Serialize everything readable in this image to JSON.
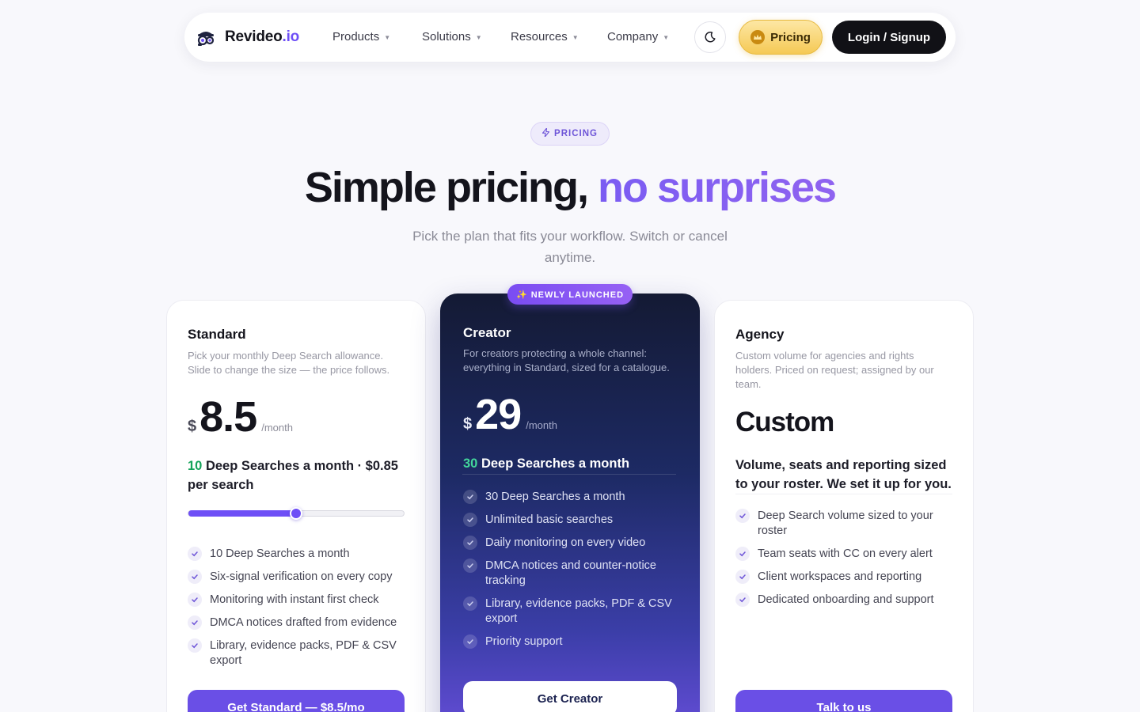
{
  "nav": {
    "brand": "Revideo",
    "brand_suffix": ".io",
    "items": [
      {
        "label": "Products"
      },
      {
        "label": "Solutions"
      },
      {
        "label": "Resources"
      },
      {
        "label": "Company"
      }
    ],
    "theme_icon": "moon-icon",
    "pricing_label": "Pricing",
    "login_label": "Login / Signup"
  },
  "hero": {
    "badge": "PRICING",
    "title_main": "Simple pricing,",
    "title_accent": "no surprises",
    "subtitle": "Pick the plan that fits your workflow. Switch or cancel anytime."
  },
  "plans": {
    "standard": {
      "name": "Standard",
      "desc": "Pick your monthly Deep Search allowance. Slide to change the size — the price follows.",
      "currency": "$",
      "price": "8.5",
      "per": "/month",
      "allowance_count": "10",
      "allowance_text": "Deep Searches a month · $0.85 per search",
      "slider_fraction": 0.5,
      "features": [
        "10 Deep Searches a month",
        "Six-signal verification on every copy",
        "Monitoring with instant first check",
        "DMCA notices drafted from evidence",
        "Library, evidence packs, PDF & CSV export"
      ],
      "cta": "Get Standard — $8.5/mo"
    },
    "creator": {
      "badge": "✨ NEWLY LAUNCHED",
      "name": "Creator",
      "desc": "For creators protecting a whole channel: everything in Standard, sized for a catalogue.",
      "currency": "$",
      "price": "29",
      "per": "/month",
      "allowance_count": "30",
      "allowance_text": "Deep Searches a month",
      "features": [
        "30 Deep Searches a month",
        "Unlimited basic searches",
        "Daily monitoring on every video",
        "DMCA notices and counter-notice tracking",
        "Library, evidence packs, PDF & CSV export",
        "Priority support"
      ],
      "cta": "Get Creator"
    },
    "agency": {
      "name": "Agency",
      "desc": "Custom volume for agencies and rights holders. Priced on request; assigned by our team.",
      "price": "Custom",
      "allowance_text": "Volume, seats and reporting sized to your roster. We set it up for you.",
      "features": [
        "Deep Search volume sized to your roster",
        "Team seats with CC on every alert",
        "Client workspaces and reporting",
        "Dedicated onboarding and support"
      ],
      "cta": "Talk to us"
    }
  }
}
